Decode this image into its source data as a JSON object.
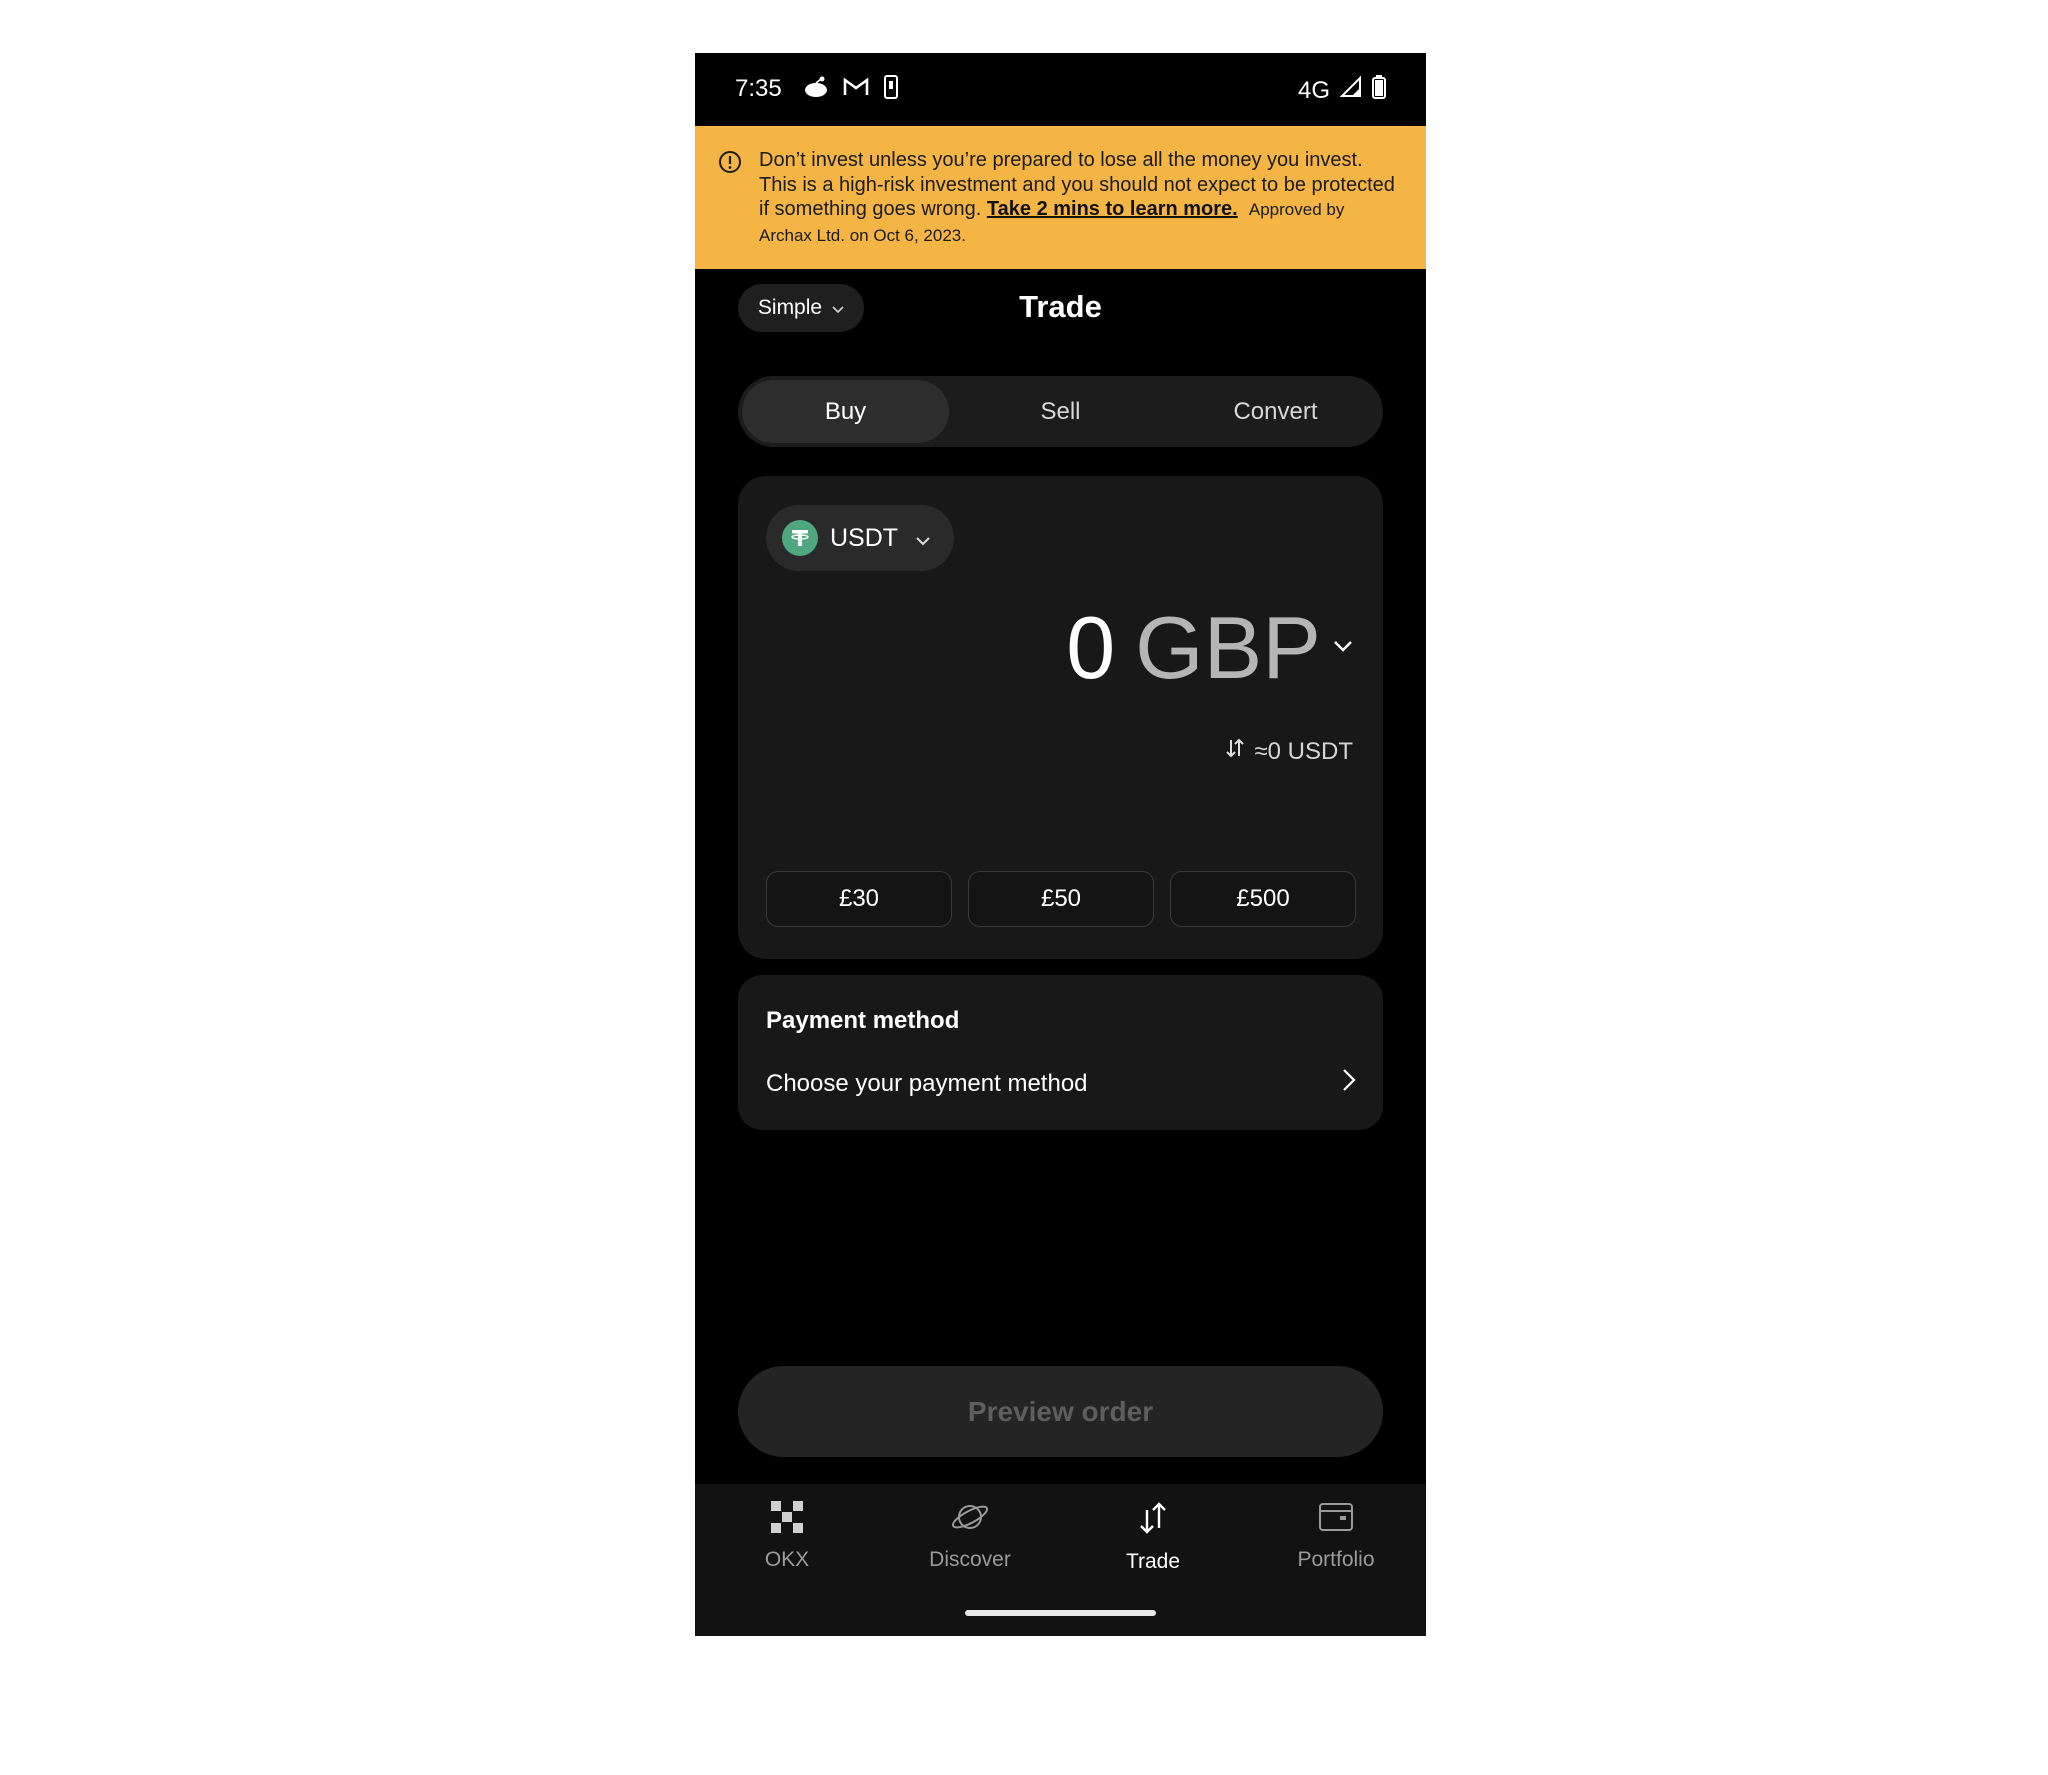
{
  "status_bar": {
    "time": "7:35",
    "network": "4G",
    "left_icons": [
      "reddit-icon",
      "gmail-icon",
      "phone-icon"
    ],
    "right_icons": [
      "signal-icon",
      "battery-icon"
    ]
  },
  "banner": {
    "text": "Don’t invest unless you’re prepared to lose all the money you invest. This is a high-risk investment and you should not expect to be protected if something goes wrong. ",
    "link_label": "Take 2 mins to learn more.",
    "approval": "Approved by Archax Ltd. on Oct 6, 2023.",
    "background_color": "#f4b545"
  },
  "header": {
    "mode_label": "Simple",
    "title": "Trade"
  },
  "tabs": [
    {
      "label": "Buy",
      "active": true
    },
    {
      "label": "Sell",
      "active": false
    },
    {
      "label": "Convert",
      "active": false
    }
  ],
  "order": {
    "coin": "USDT",
    "amount": "0",
    "fiat_currency": "GBP",
    "conversion": "≈0 USDT",
    "presets": [
      "£30",
      "£50",
      "£500"
    ],
    "coin_color": "#4ea77e"
  },
  "payment": {
    "title": "Payment method",
    "placeholder": "Choose your payment method"
  },
  "preview_button": "Preview order",
  "bottom_nav": [
    {
      "label": "OKX",
      "icon": "okx-logo-icon",
      "active": false
    },
    {
      "label": "Discover",
      "icon": "planet-icon",
      "active": false
    },
    {
      "label": "Trade",
      "icon": "trade-arrows-icon",
      "active": true
    },
    {
      "label": "Portfolio",
      "icon": "wallet-icon",
      "active": false
    }
  ]
}
